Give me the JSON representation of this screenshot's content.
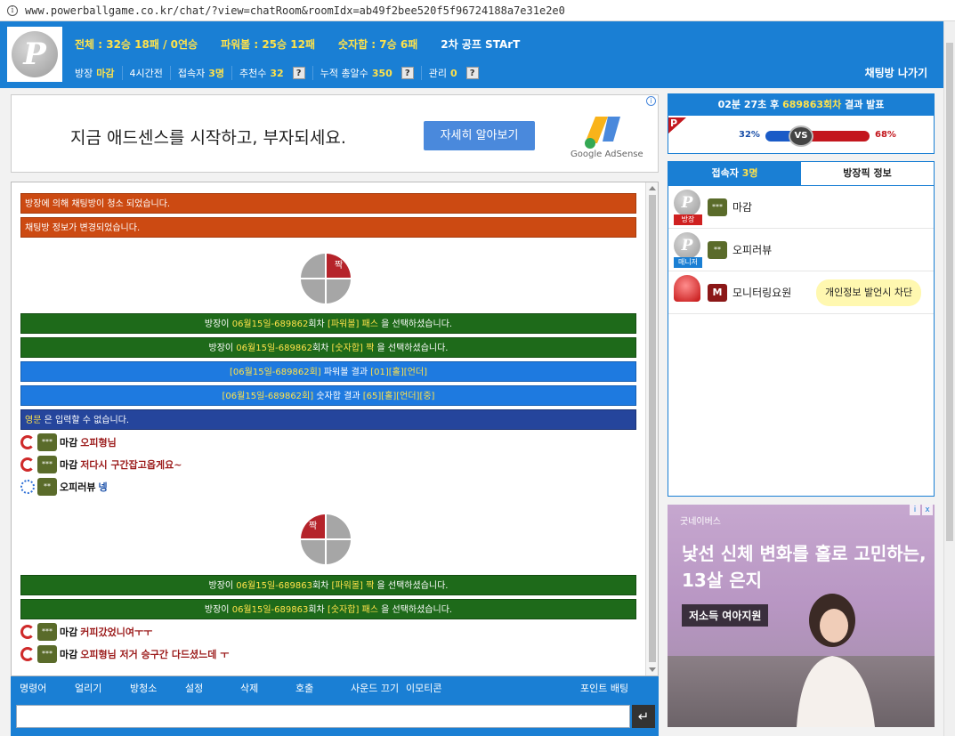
{
  "browser": {
    "url": "www.powerballgame.co.kr/chat/?view=chatRoom&roomIdx=ab49f2bee520f5f96724188a7e31e2e0"
  },
  "header": {
    "logo_letter": "P",
    "stats": {
      "total": "전체 : 32승 18패 / 0연승",
      "powerball": "파워볼 : 25승 12패",
      "sum": "숫자합 : 7승 6패",
      "start": "2차 공프 STArT"
    },
    "subbar": {
      "host_label": "방장",
      "host_name": "마감",
      "time": "4시간전",
      "users_label": "접속자",
      "users_value": "3명",
      "recommend_label": "추천수",
      "recommend_value": "32",
      "correct_label": "누적 총알수",
      "correct_value": "350",
      "admin_label": "관리",
      "admin_value": "0",
      "help": "?"
    },
    "exit_label": "채팅방 나가기"
  },
  "ad_top": {
    "headline": "지금 애드센스를 시작하고, 부자되세요.",
    "cta": "자세히 알아보기",
    "brand": "Google AdSense",
    "info": "i"
  },
  "chat": {
    "notices": [
      "방장에 의해 채팅방이 청소 되었습니다.",
      "채팅방 정보가 변경되었습니다."
    ],
    "pie1_label": "짝",
    "pie2_label": "짝",
    "round1": {
      "prefix": "방장이",
      "date_round": "06월15일-689862",
      "suffix_round": "회차",
      "pick1": "[파워볼] 패스",
      "pick2": "[숫자합] 짝",
      "tail": "을 선택하셨습니다."
    },
    "result1": {
      "powerball_pre": "[06월15일-689862회]",
      "powerball_mid": "파워볼 결과",
      "powerball_val": "[01][홀][언더]",
      "sum_pre": "[06월15일-689862회]",
      "sum_mid": "숫자합 결과",
      "sum_val": "[65][홀][언더][중]"
    },
    "english_notice_y": "영문",
    "english_notice_rest": "은 입력할 수 없습니다.",
    "lines": [
      {
        "nick": "마감",
        "text": "오피형님",
        "badge": "***"
      },
      {
        "nick": "마감",
        "text": "저다시 구간잡고옵게요~",
        "badge": "***"
      },
      {
        "nick": "오피러뷰",
        "text": "넹",
        "badge": "**"
      }
    ],
    "round2": {
      "prefix": "방장이",
      "date_round": "06월15일-689863",
      "suffix_round": "회차",
      "pick1": "[파워볼] 짝",
      "pick2": "[숫자합] 패스",
      "tail": "을 선택하셨습니다."
    },
    "lines2": [
      {
        "nick": "마감",
        "text": "커피갔었니여ㅜㅜ",
        "badge": "***"
      },
      {
        "nick": "마감",
        "text": "오피형님 저거 승구간 다드셨느데 ㅜ",
        "badge": "***"
      }
    ]
  },
  "chat_menu": {
    "items": [
      "명령어",
      "얼리기",
      "방청소",
      "설정",
      "삭제",
      "호출",
      "사운드 끄기",
      "이모티콘"
    ],
    "point": "포인트 배팅",
    "send": "↵"
  },
  "result_box": {
    "time": "02분 27초",
    "mid": "후",
    "round": "689863회차",
    "tail": "결과 발표",
    "flag": "P",
    "left_pct": "32%",
    "right_pct": "68%",
    "vs": "VS",
    "left_ratio": 0.32,
    "right_ratio": 0.68
  },
  "users_panel": {
    "tab_users_label": "접속자",
    "tab_users_count": "3명",
    "tab_info": "방장픽 정보",
    "users": [
      {
        "name": "마감",
        "role": "방장",
        "badge": "***"
      },
      {
        "name": "오피러뷰",
        "role": "매니저",
        "badge": "**"
      },
      {
        "name": "모니터링요원",
        "role": "",
        "badge": "M"
      }
    ],
    "tooltip": "개인정보 발언시 차단"
  },
  "ad_side": {
    "brand": "굿네이버스",
    "headline_1": "낯선 신체 변화를 홀로 고민하는,",
    "headline_2": "13살 은지",
    "tag": "저소득 여아지원",
    "info": "i",
    "close": "x"
  },
  "colors": {
    "primary_blue": "#1a7fd4",
    "yellow": "#ffe24a",
    "notice_orange": "#cc4a12",
    "pick_green": "#1e6a1a",
    "result_blue": "#1e7ae0",
    "notice_navy": "#25459c",
    "red": "#c3161d"
  }
}
